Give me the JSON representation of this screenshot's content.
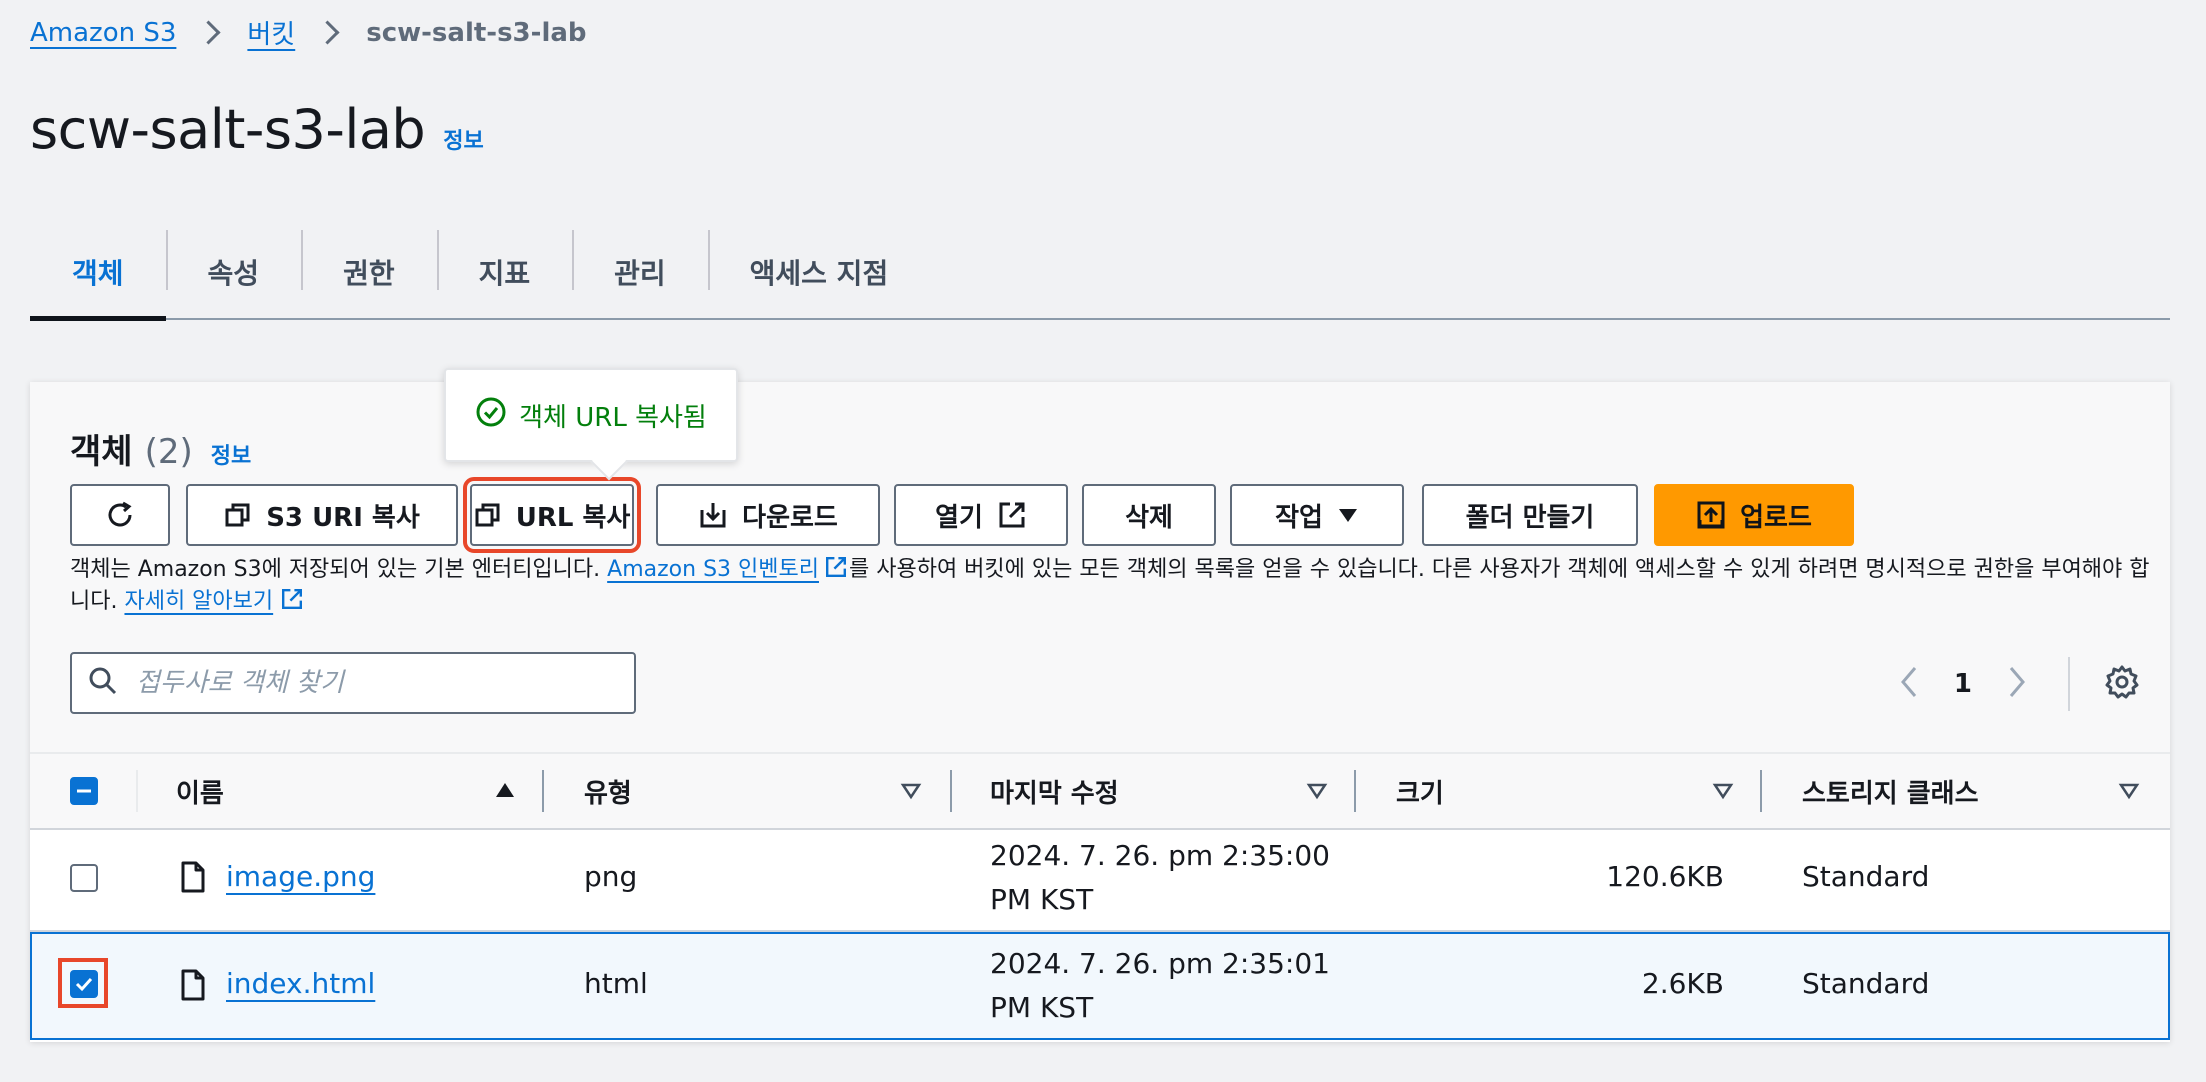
{
  "breadcrumb": {
    "root": "Amazon S3",
    "buckets": "버킷",
    "current": "scw-salt-s3-lab"
  },
  "page": {
    "title": "scw-salt-s3-lab",
    "info": "정보"
  },
  "tabs": [
    {
      "label": "객체",
      "active": true
    },
    {
      "label": "속성"
    },
    {
      "label": "권한"
    },
    {
      "label": "지표"
    },
    {
      "label": "관리"
    },
    {
      "label": "액세스 지점"
    }
  ],
  "objects": {
    "title": "객체",
    "count": "(2)",
    "info": "정보"
  },
  "toast": {
    "message": "객체 URL 복사됨"
  },
  "toolbar": {
    "copy_s3_uri": "S3 URI 복사",
    "copy_url": "URL 복사",
    "download": "다운로드",
    "open": "열기",
    "delete": "삭제",
    "actions": "작업",
    "create_folder": "폴더 만들기",
    "upload": "업로드"
  },
  "description": {
    "part1": "객체는 Amazon S3에 저장되어 있는 기본 엔터티입니다. ",
    "inventory_link": "Amazon S3 인벤토리",
    "part2": "를 사용하여 버킷에 있는 모든 객체의 목록을 얻을 수 있습니다. 다른 사용자가 객체에 액세스할 수 있게 하려면 명시적으로 권한을 부여해야 합니다. ",
    "learn_more": "자세히 알아보기"
  },
  "search": {
    "placeholder": "접두사로 객체 찾기",
    "value": ""
  },
  "pagination": {
    "current_page": "1"
  },
  "table": {
    "columns": {
      "name": "이름",
      "type": "유형",
      "last_modified": "마지막 수정",
      "size": "크기",
      "storage_class": "스토리지 클래스"
    },
    "rows": [
      {
        "name": "image.png",
        "type": "png",
        "date_line1": "2024. 7. 26. pm 2:35:00",
        "date_line2": "PM KST",
        "size": "120.6KB",
        "storage_class": "Standard",
        "selected": false
      },
      {
        "name": "index.html",
        "type": "html",
        "date_line1": "2024. 7. 26. pm 2:35:01",
        "date_line2": "PM KST",
        "size": "2.6KB",
        "storage_class": "Standard",
        "selected": true
      }
    ]
  },
  "colors": {
    "link": "#0972d3",
    "primary_button": "#ff9900",
    "highlight": "#e8472a",
    "success": "#037f0c"
  }
}
